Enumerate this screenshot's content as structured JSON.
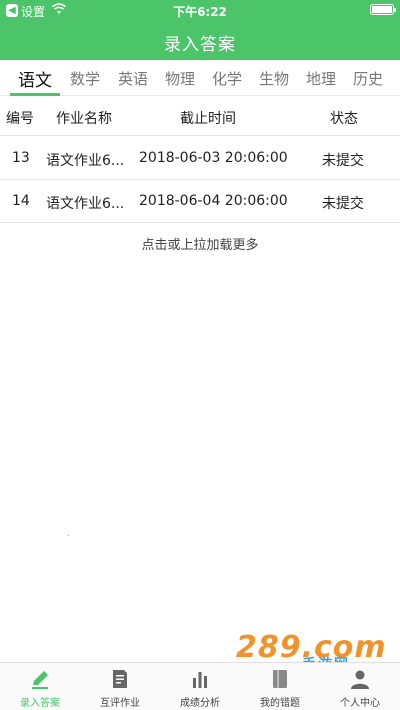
{
  "status_bar": {
    "carrier": "设置",
    "time": "下午6:22"
  },
  "header": {
    "title": "录入答案"
  },
  "tabs": [
    {
      "label": "语文",
      "active": true
    },
    {
      "label": "数学",
      "active": false
    },
    {
      "label": "英语",
      "active": false
    },
    {
      "label": "物理",
      "active": false
    },
    {
      "label": "化学",
      "active": false
    },
    {
      "label": "生物",
      "active": false
    },
    {
      "label": "地理",
      "active": false
    },
    {
      "label": "历史",
      "active": false
    }
  ],
  "table": {
    "columns": {
      "no": "编号",
      "name": "作业名称",
      "deadline": "截止时间",
      "status": "状态"
    },
    "rows": [
      {
        "no": "13",
        "name": "语文作业6...",
        "deadline": "2018-06-03 20:06:00",
        "status": "未提交"
      },
      {
        "no": "14",
        "name": "语文作业6...",
        "deadline": "2018-06-04 20:06:00",
        "status": "未提交"
      }
    ]
  },
  "load_more": "点击或上拉加载更多",
  "watermark": {
    "main": "289.com",
    "sub": "手游网"
  },
  "bottom_nav": [
    {
      "label": "录入答案",
      "icon": "pencil-icon",
      "active": true
    },
    {
      "label": "互评作业",
      "icon": "document-icon",
      "active": false
    },
    {
      "label": "成绩分析",
      "icon": "bar-chart-icon",
      "active": false
    },
    {
      "label": "我的错题",
      "icon": "notebook-icon",
      "active": false
    },
    {
      "label": "个人中心",
      "icon": "person-icon",
      "active": false
    }
  ],
  "colors": {
    "accent": "#4cc46a",
    "inactive": "#777777"
  }
}
